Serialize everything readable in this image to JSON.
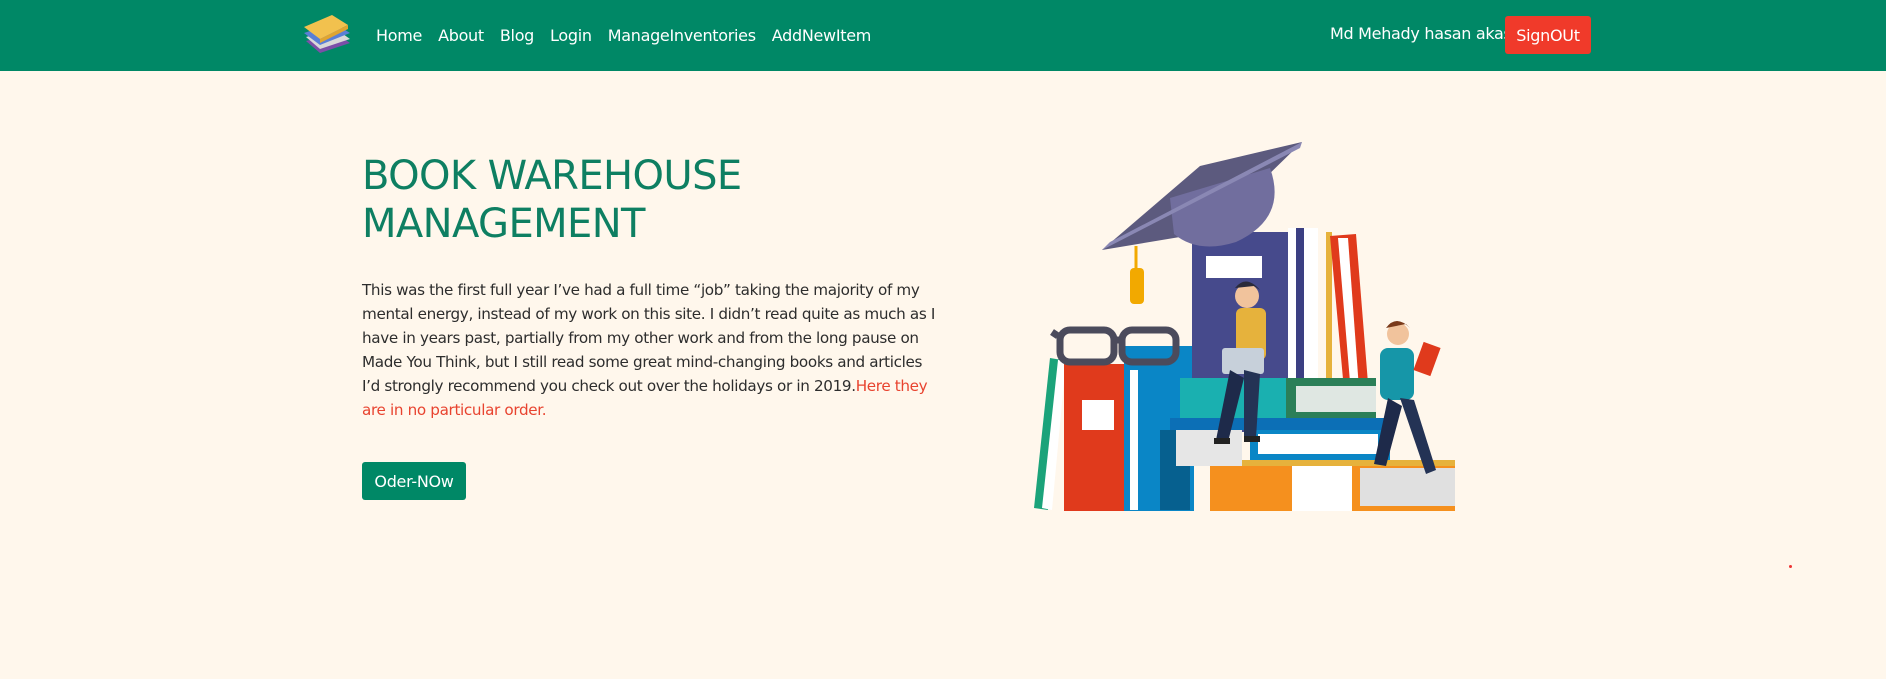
{
  "nav": {
    "items": [
      {
        "label": "Home"
      },
      {
        "label": "About"
      },
      {
        "label": "Blog"
      },
      {
        "label": "Login"
      },
      {
        "label": "ManageInventories"
      },
      {
        "label": "AddNewItem"
      }
    ],
    "user_name": "Md Mehady hasan akash",
    "signout_label": "SignOUt",
    "logo_icon": "books-stack-icon"
  },
  "hero": {
    "title": "BOOK WAREHOUSE MANAGEMENT",
    "body": "This was the first full year I’ve had a full time “job” taking the majority of my mental energy, instead of my work on this site. I didn’t read quite as much as I have in years past, partially from my other work and from the long pause on Made You Think, but I still read some great mind-changing books and articles I’d strongly recommend you check out over the holidays or in 2019.",
    "link_text": "Here they are in no particular order.",
    "button_label": "Oder-NOw",
    "illustration": "students-reading-books-illustration"
  },
  "colors": {
    "navbar": "#008866",
    "background": "#fff7ec",
    "accent": "#0e7f62",
    "signout": "#f03a2a",
    "link": "#e8432f"
  }
}
